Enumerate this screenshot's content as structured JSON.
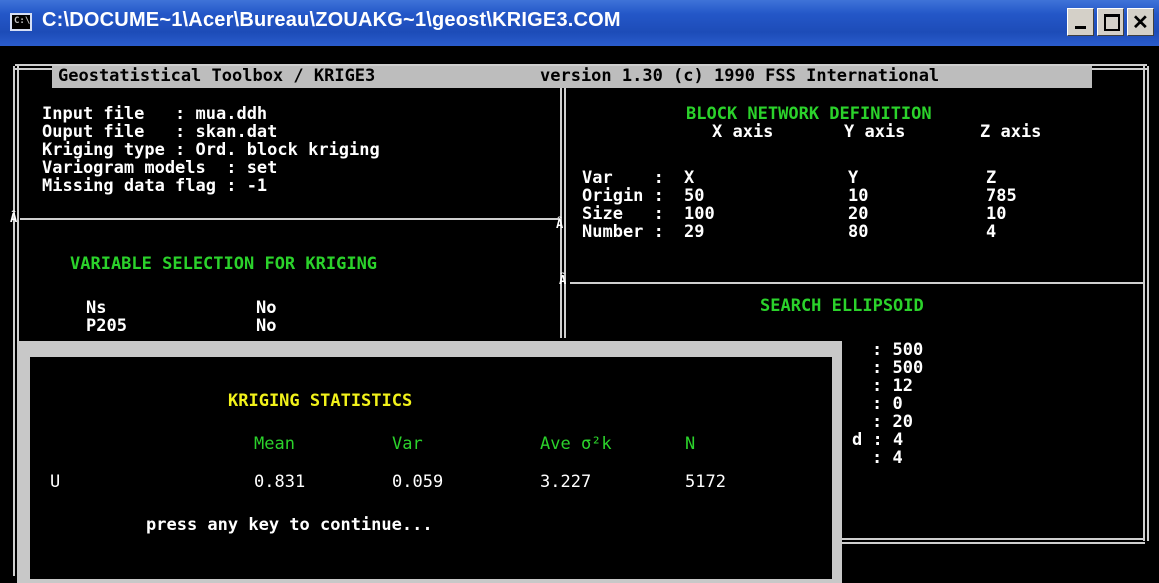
{
  "window": {
    "title": "C:\\DOCUME~1\\Acer\\Bureau\\ZOUAKG~1\\geost\\KRIGE3.COM",
    "app_icon": "console-icon",
    "app_icon_text": "C:\\",
    "buttons": {
      "minimize": "minimize-icon",
      "maximize": "maximize-icon",
      "close": "close-icon"
    }
  },
  "header": {
    "left": "Geostatistical Toolbox / KRIGE3",
    "right": "version 1.30 (c) 1990 FSS International"
  },
  "files": {
    "input": "Input file   : mua.ddh",
    "output": "Ouput file   : skan.dat",
    "kriging_type": "Kriging type : Ord. block kriging",
    "variogram": "Variogram models  : set",
    "missing": "Missing data flag : -1"
  },
  "variable_selection": {
    "title": "VARIABLE SELECTION FOR KRIGING",
    "rows": [
      {
        "name": "Ns",
        "value": "No"
      },
      {
        "name": "P205",
        "value": "No"
      }
    ]
  },
  "block_network": {
    "title": "BLOCK NETWORK DEFINITION",
    "columns": [
      "X axis",
      "Y axis",
      "Z axis"
    ],
    "rows": [
      {
        "label": "Var    :",
        "x": "X",
        "y": "Y",
        "z": "Z"
      },
      {
        "label": "Origin :",
        "x": "50",
        "y": "10",
        "z": "785"
      },
      {
        "label": "Size   :",
        "x": "100",
        "y": "20",
        "z": "10"
      },
      {
        "label": "Number :",
        "x": "29",
        "y": "80",
        "z": "4"
      }
    ]
  },
  "search_ellipsoid": {
    "title": "SEARCH ELLIPSOID",
    "values": [
      ": 500",
      ": 500",
      ": 12",
      ": 0",
      ": 20",
      "d : 4",
      ": 4"
    ]
  },
  "border_marker": "Â",
  "kriging_statistics": {
    "title": "KRIGING STATISTICS",
    "columns": [
      "Mean",
      "Var",
      "Ave σ²k",
      "N"
    ],
    "row": {
      "variable": "U",
      "mean": "0.831",
      "var": "0.059",
      "ave": "3.227",
      "n": "5172"
    },
    "prompt": "press any key to continue..."
  },
  "colors": {
    "green": "#2bd22b",
    "yellow": "#f2f21a",
    "text": "#ffffff",
    "titlebar": "#2457c8"
  }
}
